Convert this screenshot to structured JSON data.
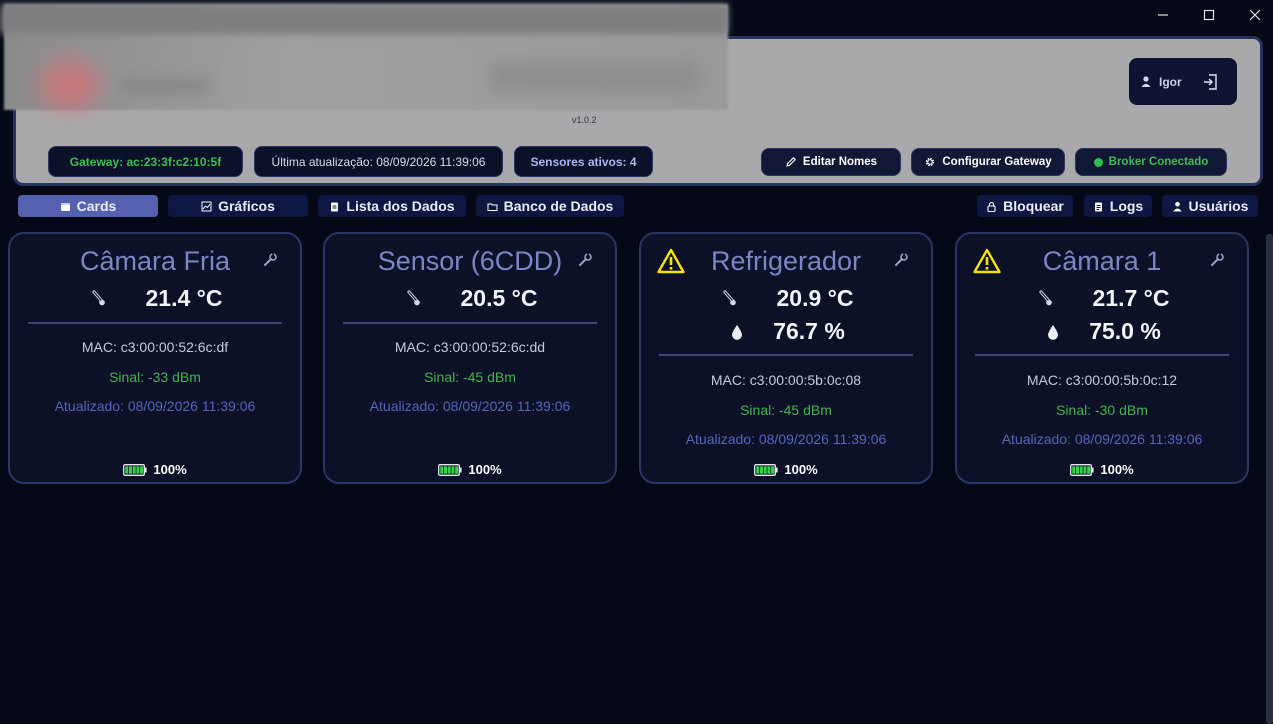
{
  "window": {
    "minimize": "—",
    "maximize": "☐",
    "close": "✕"
  },
  "header": {
    "version": "v1.0.2",
    "user_name": "Igor",
    "gateway": "Gateway: ac:23:3f:c2:10:5f",
    "last_update": "Última atualização: 08/09/2026 11:39:06",
    "active_sensors": "Sensores ativos: 4",
    "edit_names": "Editar Nomes",
    "configure_gateway": "Configurar Gateway",
    "broker_status": "Broker Conectado"
  },
  "nav": {
    "cards": "Cards",
    "charts": "Gráficos",
    "data_list": "Lista dos Dados",
    "database": "Banco de Dados",
    "lock": "Bloquear",
    "logs": "Logs",
    "users": "Usuários"
  },
  "cards": [
    {
      "title": "Câmara Fria",
      "warning": false,
      "temperature": "21.4 °C",
      "humidity": "",
      "mac": "MAC: c3:00:00:52:6c:df",
      "signal": "Sinal: -33 dBm",
      "updated": "Atualizado: 08/09/2026 11:39:06",
      "battery": "100%",
      "battery_level": 1.0
    },
    {
      "title": "Sensor (6CDD)",
      "warning": false,
      "temperature": "20.5 °C",
      "humidity": "",
      "mac": "MAC: c3:00:00:52:6c:dd",
      "signal": "Sinal: -45 dBm",
      "updated": "Atualizado: 08/09/2026 11:39:06",
      "battery": "100%",
      "battery_level": 1.0
    },
    {
      "title": "Refrigerador",
      "warning": true,
      "temperature": "20.9 °C",
      "humidity": "76.7 %",
      "mac": "MAC: c3:00:00:5b:0c:08",
      "signal": "Sinal: -45 dBm",
      "updated": "Atualizado: 08/09/2026 11:39:06",
      "battery": "100%",
      "battery_level": 1.0
    },
    {
      "title": "Câmara 1",
      "warning": true,
      "temperature": "21.7 °C",
      "humidity": "75.0 %",
      "mac": "MAC: c3:00:00:5b:0c:12",
      "signal": "Sinal: -30 dBm",
      "updated": "Atualizado: 08/09/2026 11:39:06",
      "battery": "100%",
      "battery_level": 1.0
    }
  ],
  "colors": {
    "signal": "#41b34e",
    "warning": "#f5e400",
    "accent": "#5461b0"
  }
}
